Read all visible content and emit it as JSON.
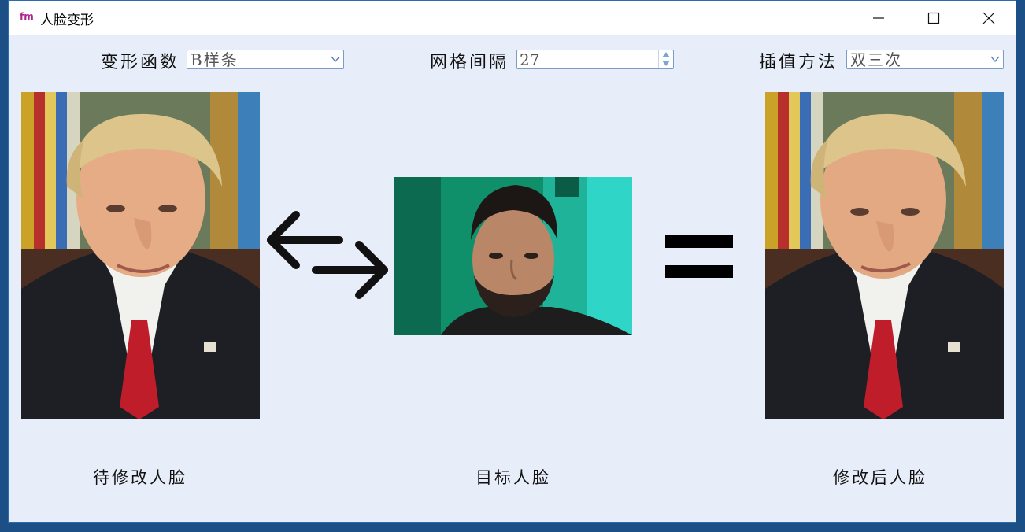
{
  "window": {
    "app_icon": "fm",
    "title": "人脸变形",
    "controls": [
      "minimize-icon",
      "maximize-icon",
      "close-icon"
    ]
  },
  "toolbar": {
    "warp_function": {
      "label": "变形函数",
      "value": "B样条"
    },
    "grid_spacing": {
      "label": "网格间隔",
      "value": "27"
    },
    "interpolation": {
      "label": "插值方法",
      "value": "双三次"
    }
  },
  "images": {
    "source": {
      "caption": "待修改人脸"
    },
    "target": {
      "caption": "目标人脸"
    },
    "result": {
      "caption": "修改后人脸"
    }
  },
  "symbols": {
    "between_source_target": "swap-arrows-icon",
    "between_target_result": "equals-icon"
  },
  "colors": {
    "window_bg": "#e8eef9",
    "title_bar": "#ffffff",
    "desktop": "#1c4f86",
    "field_border": "#7a9cc6"
  }
}
